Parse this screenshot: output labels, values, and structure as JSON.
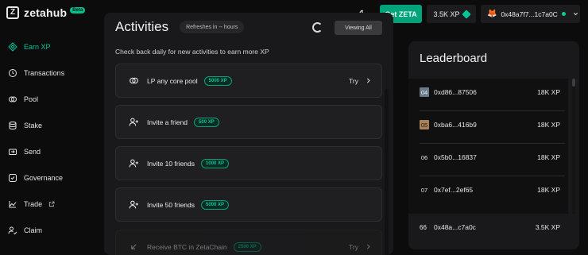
{
  "header": {
    "logo_text": "zetahub",
    "beta_badge": "Beta",
    "theme_icon": "moon-icon",
    "get_zeta_label": "Get ZETA",
    "xp_total": "3.5K XP",
    "wallet_address": "0x48a7f7...1c7a0C",
    "wallet_status_color": "#00d08f"
  },
  "sidebar": {
    "items": [
      {
        "label": "Earn XP",
        "icon": "diamond-icon",
        "active": true
      },
      {
        "label": "Transactions",
        "icon": "clock-icon"
      },
      {
        "label": "Pool",
        "icon": "pool-icon"
      },
      {
        "label": "Stake",
        "icon": "stack-icon"
      },
      {
        "label": "Send",
        "icon": "send-icon"
      },
      {
        "label": "Governance",
        "icon": "governance-icon"
      },
      {
        "label": "Trade",
        "icon": "trade-icon"
      },
      {
        "label": "Claim",
        "icon": "claim-icon"
      }
    ]
  },
  "activities": {
    "title": "Activities",
    "refresh_text": "Refreshes in -- hours",
    "filter_label": "Viewing All",
    "subtitle": "Check back daily for new activities to earn more XP",
    "try_label": "Try",
    "items": [
      {
        "label": "LP any core pool",
        "xp": "5000 XP",
        "icon": "pool-icon",
        "has_try": true
      },
      {
        "label": "Invite a friend",
        "xp": "500 XP",
        "icon": "add-user-icon"
      },
      {
        "label": "Invite 10 friends",
        "xp": "1000 XP",
        "icon": "add-user-icon"
      },
      {
        "label": "Invite 50 friends",
        "xp": "5000 XP",
        "icon": "add-user-icon"
      },
      {
        "label": "Receive BTC in ZetaChain",
        "xp": "2500 XP",
        "icon": "arrow-down-left-icon",
        "has_try": true
      }
    ]
  },
  "leaderboard": {
    "title": "Leaderboard",
    "rows": [
      {
        "rank": "04",
        "address": "0xd86...87506",
        "xp": "18K XP"
      },
      {
        "rank": "05",
        "address": "0xba6...416b9",
        "xp": "18K XP"
      },
      {
        "rank": "06",
        "address": "0x5b0...16837",
        "xp": "18K XP"
      },
      {
        "rank": "07",
        "address": "0x7ef...2ef65",
        "xp": "18K XP"
      }
    ],
    "me": {
      "rank": "66",
      "address": "0x48a...c7a0c",
      "xp": "3.5K XP"
    }
  },
  "colors": {
    "accent": "#00c59a",
    "button_green": "#00a47a",
    "background": "#0c0c0d",
    "card": "#19191b"
  }
}
